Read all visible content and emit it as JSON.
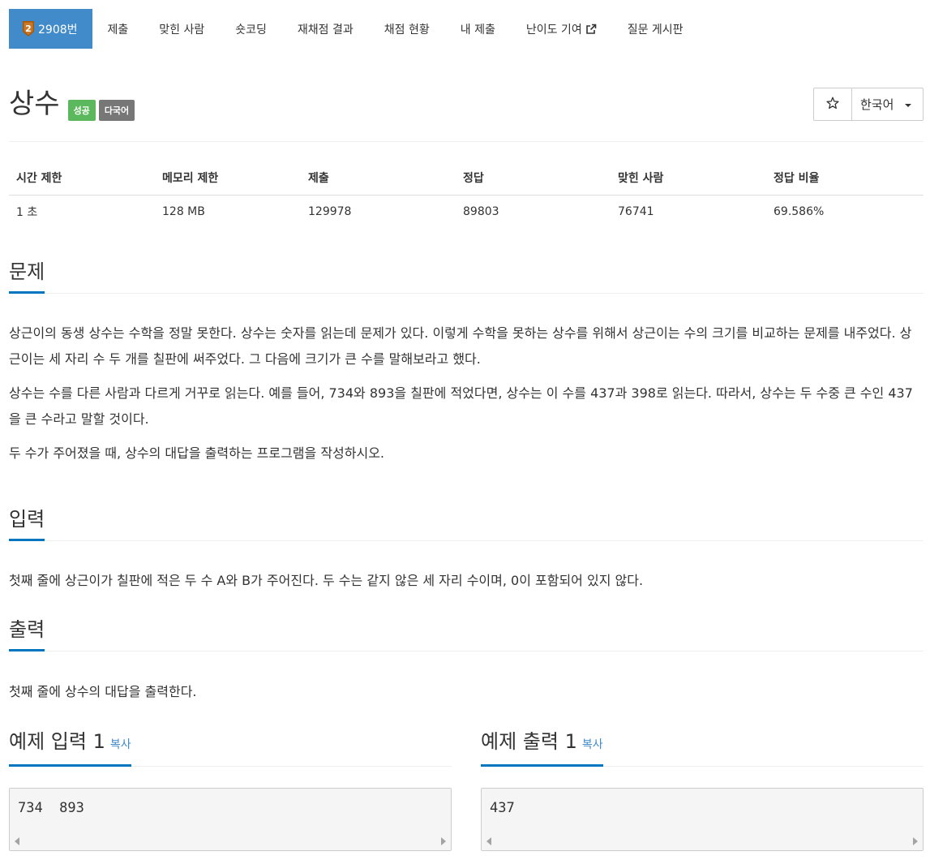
{
  "nav": {
    "problem_number": "2908번",
    "tier_level": "2",
    "items": [
      "제출",
      "맞힌 사람",
      "숏코딩",
      "재채점 결과",
      "채점 현황",
      "내 제출",
      "난이도 기여",
      "질문 게시판"
    ],
    "accent_color": "#428bca"
  },
  "problem": {
    "title": "상수",
    "labels": [
      "성공",
      "다국어"
    ],
    "language": "한국어"
  },
  "info_table": {
    "headers": [
      "시간 제한",
      "메모리 제한",
      "제출",
      "정답",
      "맞힌 사람",
      "정답 비율"
    ],
    "values": [
      "1 초",
      "128 MB",
      "129978",
      "89803",
      "76741",
      "69.586%"
    ]
  },
  "sections": {
    "description": {
      "heading": "문제",
      "paragraphs": [
        "상근이의 동생 상수는 수학을 정말 못한다. 상수는 숫자를 읽는데 문제가 있다. 이렇게 수학을 못하는 상수를 위해서 상근이는 수의 크기를 비교하는 문제를 내주었다. 상근이는 세 자리 수 두 개를 칠판에 써주었다. 그 다음에 크기가 큰 수를 말해보라고 했다.",
        "상수는 수를 다른 사람과 다르게 거꾸로 읽는다. 예를 들어, 734와 893을 칠판에 적었다면, 상수는 이 수를 437과 398로 읽는다. 따라서, 상수는 두 수중 큰 수인 437을 큰 수라고 말할 것이다.",
        "두 수가 주어졌을 때, 상수의 대답을 출력하는 프로그램을 작성하시오."
      ]
    },
    "input": {
      "heading": "입력",
      "text": "첫째 줄에 상근이가 칠판에 적은 두 수 A와 B가 주어진다. 두 수는 같지 않은 세 자리 수이며, 0이 포함되어 있지 않다."
    },
    "output": {
      "heading": "출력",
      "text": "첫째 줄에 상수의 대답을 출력한다."
    }
  },
  "samples": {
    "copy_label": "복사",
    "input": {
      "heading": "예제 입력 1",
      "content": "734  893"
    },
    "output": {
      "heading": "예제 출력 1",
      "content": "437"
    }
  }
}
